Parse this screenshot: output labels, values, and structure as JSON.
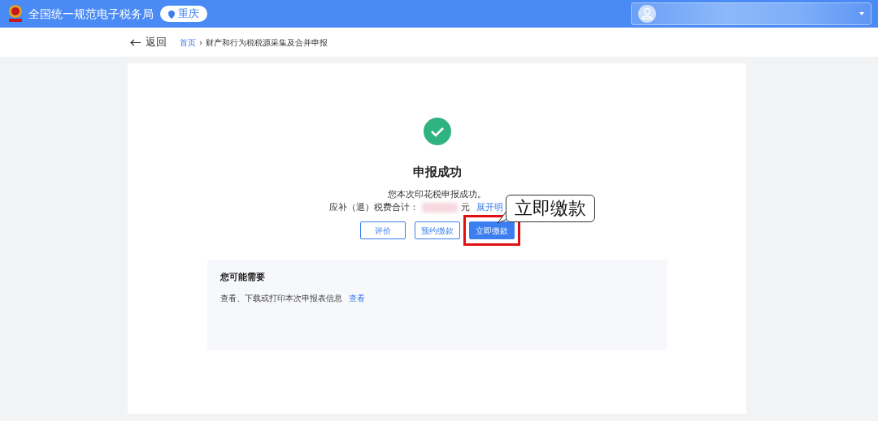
{
  "header": {
    "title": "全国统一规范电子税务局",
    "region": "重庆"
  },
  "nav": {
    "back": "返回",
    "breadcrumb": [
      {
        "label": "首页"
      },
      {
        "label": "财产和行为税税源采集及合并申报"
      }
    ],
    "separator": "›"
  },
  "result": {
    "title": "申报成功",
    "message": "您本次印花税申报成功。",
    "amount_label": "应补（退）税费合计：",
    "currency": "元",
    "details_link": "展开明"
  },
  "buttons": [
    {
      "label": "评价",
      "kind": "outline",
      "highlighted": false
    },
    {
      "label": "预约缴款",
      "kind": "outline",
      "highlighted": false
    },
    {
      "label": "立即缴款",
      "kind": "primary",
      "highlighted": true
    }
  ],
  "callout": {
    "text": "立即缴款"
  },
  "suggestions": {
    "title": "您可能需要",
    "items": [
      {
        "text": "查看、下载或打印本次申报表信息",
        "link": "查看"
      }
    ]
  }
}
